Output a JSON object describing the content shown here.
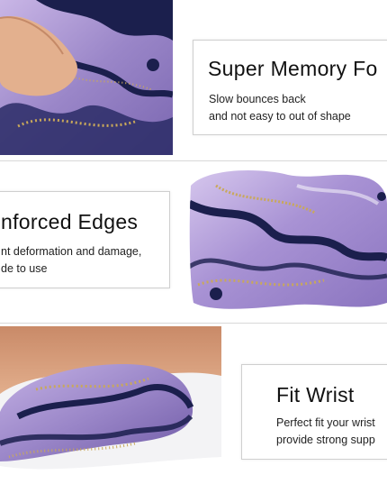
{
  "panels": [
    {
      "title": "Super Memory Fo",
      "desc": [
        "Slow bounces back",
        "and not easy to out of shape"
      ]
    },
    {
      "title": "nforced Edges",
      "desc": [
        "nt deformation and damage,",
        "de to use"
      ]
    },
    {
      "title": "Fit Wrist",
      "desc": [
        "Perfect fit your wrist",
        "provide strong supp"
      ]
    }
  ],
  "colors": {
    "purple_marble": "#9a86c8",
    "navy_vein": "#1b1f4d",
    "gold_fleck": "#c9a85a",
    "skin": "#d9a07e",
    "border": "#cfcfcf"
  }
}
